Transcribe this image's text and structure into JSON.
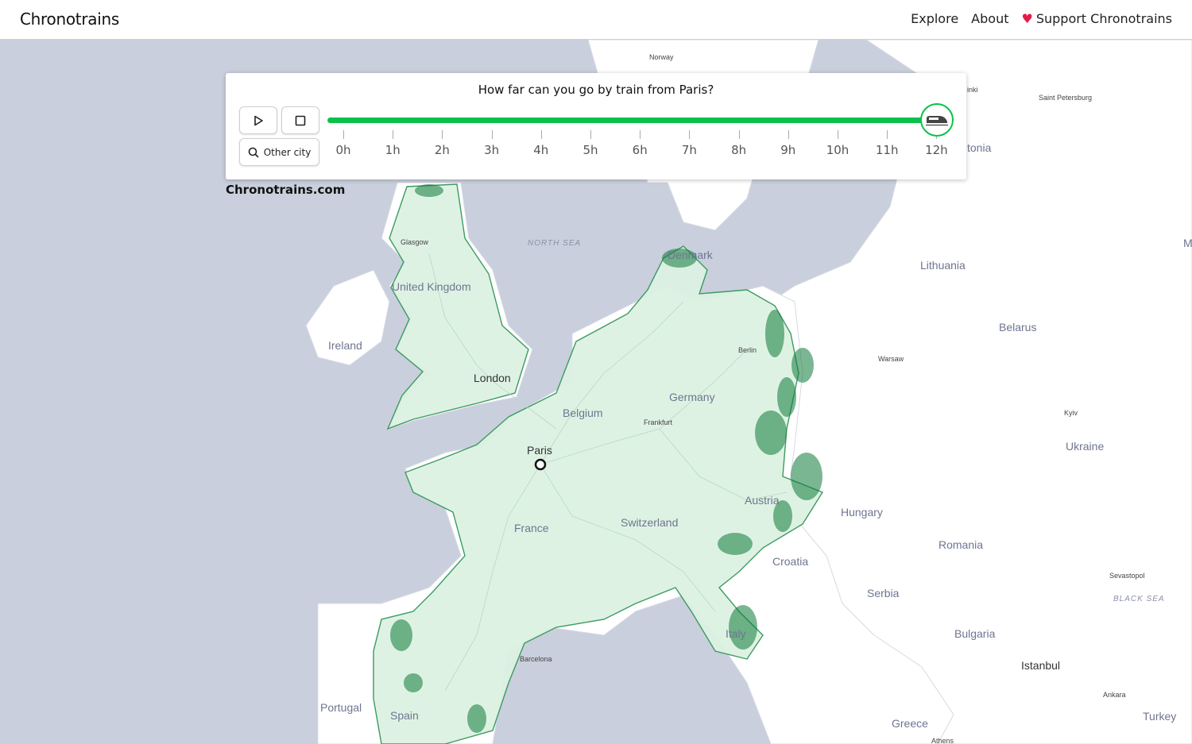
{
  "brand": "Chronotrains",
  "nav": {
    "explore": "Explore",
    "about": "About",
    "support": "Support Chronotrains"
  },
  "panel": {
    "title": "How far can you go by train from Paris?",
    "other_city_label": "Other city",
    "ticks": [
      "0h",
      "1h",
      "2h",
      "3h",
      "4h",
      "5h",
      "6h",
      "7h",
      "8h",
      "9h",
      "10h",
      "11h",
      "12h"
    ],
    "slider_value_hours": 12
  },
  "watermark": "Chronotrains.com",
  "map": {
    "origin": "Paris",
    "labels": {
      "norway": "Norway",
      "saint_petersburg": "Saint Petersburg",
      "estonia": "tonia",
      "helsinki": "inki",
      "north_sea": "NORTH SEA",
      "glasgow": "Glasgow",
      "denmark": "Denmark",
      "united_kingdom": "United Kingdom",
      "lithuania": "Lithuania",
      "ireland": "Ireland",
      "belarus": "Belarus",
      "berlin": "Berlin",
      "warsaw": "Warsaw",
      "london": "London",
      "germany": "Germany",
      "belgium": "Belgium",
      "frankfurt": "Frankfurt",
      "kyiv": "Kyiv",
      "paris": "Paris",
      "ukraine": "Ukraine",
      "austria": "Austria",
      "hungary": "Hungary",
      "switzerland": "Switzerland",
      "france": "France",
      "romania": "Romania",
      "croatia": "Croatia",
      "sevastopol": "Sevastopol",
      "black_sea": "BLACK SEA",
      "serbia": "Serbia",
      "italy": "Italy",
      "bulgaria": "Bulgaria",
      "barcelona": "Barcelona",
      "istanbul": "Istanbul",
      "ankara": "Ankara",
      "portugal": "Portugal",
      "spain": "Spain",
      "greece": "Greece",
      "turkey": "Turkey",
      "athens": "Athens",
      "edge_m": "M"
    }
  },
  "colors": {
    "accent": "#0bc14b",
    "reach_fill": "#dcf1e2",
    "reach_edge": "#3d9a62",
    "hotspot": "#0e7a3a",
    "sea": "#c9cfdc",
    "land": "#ffffff",
    "heart": "#e11d48"
  }
}
